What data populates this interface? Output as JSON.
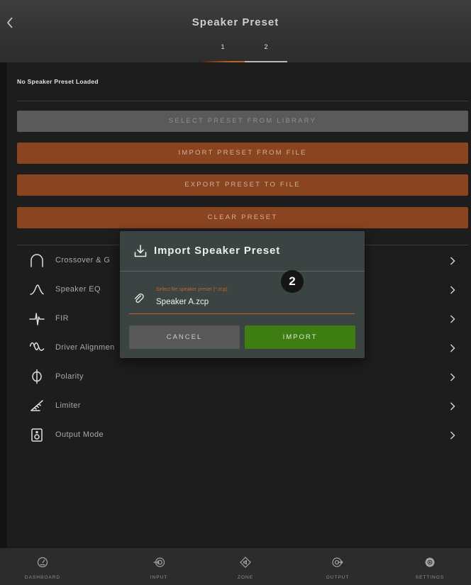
{
  "header": {
    "back_icon": "chevron-left-icon",
    "title": "Speaker Preset",
    "tabs": [
      {
        "label": "1",
        "active": true
      },
      {
        "label": "2",
        "active": false
      }
    ]
  },
  "preset_status": "No Speaker Preset Loaded",
  "actions": [
    {
      "label": "SELECT PRESET FROM LIBRARY",
      "enabled": false
    },
    {
      "label": "IMPORT PRESET FROM FILE",
      "enabled": true
    },
    {
      "label": "EXPORT PRESET TO FILE",
      "enabled": true
    },
    {
      "label": "CLEAR PRESET",
      "enabled": true
    }
  ],
  "menu": [
    {
      "label": "Crossover & G",
      "icon": "crossover-icon"
    },
    {
      "label": "Speaker EQ",
      "icon": "speaker-eq-icon"
    },
    {
      "label": "FIR",
      "icon": "fir-icon"
    },
    {
      "label": "Driver Alignmen",
      "icon": "driver-alignment-icon"
    },
    {
      "label": "Polarity",
      "icon": "polarity-icon"
    },
    {
      "label": "Limiter",
      "icon": "limiter-icon"
    },
    {
      "label": "Output Mode",
      "icon": "output-mode-icon"
    }
  ],
  "menu_chevron_icon": "chevron-right-icon",
  "dialog": {
    "icon": "download-icon",
    "title": "Import Speaker Preset",
    "step_badge": "2",
    "file_field": {
      "icon": "paperclip-icon",
      "label": "Select file speaker preset (*.zcp)",
      "value": "Speaker A.zcp"
    },
    "cancel_label": "CANCEL",
    "import_label": "IMPORT"
  },
  "bottom_nav": [
    {
      "label": "DASHBOARD",
      "icon": "dashboard-icon"
    },
    {
      "label": "INPUT",
      "icon": "input-icon"
    },
    {
      "label": "ZONE",
      "icon": "zone-icon"
    },
    {
      "label": "OUTPUT",
      "icon": "output-icon"
    },
    {
      "label": "SETTINGS",
      "icon": "settings-icon"
    }
  ],
  "colors": {
    "accent": "#c0622a",
    "action_button": "#8a4420",
    "disabled_button": "#5a5a5a",
    "import_button": "#3e7d12",
    "dialog_background": "#3c4443"
  }
}
